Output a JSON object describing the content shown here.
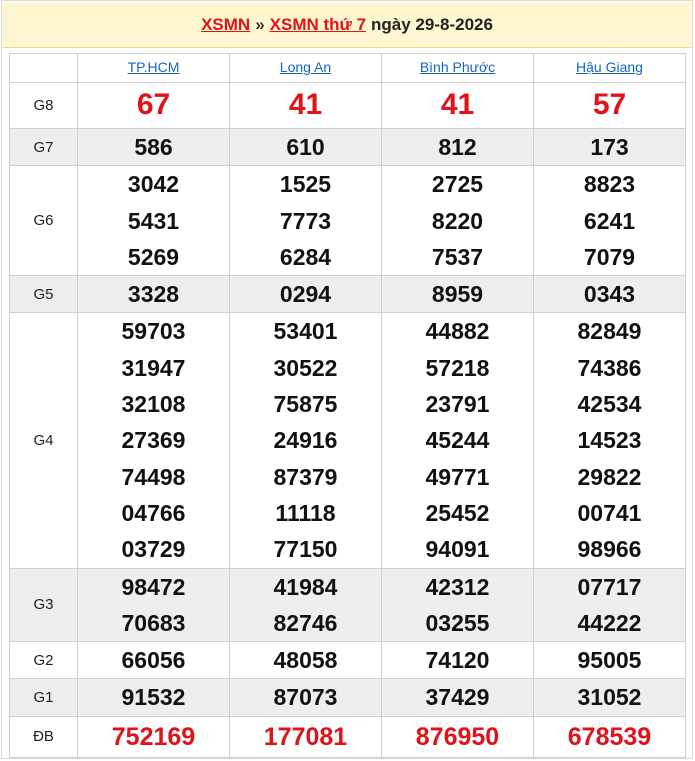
{
  "header": {
    "link1": "XSMN",
    "separator": "»",
    "link2": "XSMN thứ 7",
    "date": "ngày 29-8-2026"
  },
  "provinces": [
    "TP.HCM",
    "Long An",
    "Bình Phước",
    "Hậu Giang"
  ],
  "prizes": [
    {
      "label": "G8",
      "values": [
        [
          "67"
        ],
        [
          "41"
        ],
        [
          "41"
        ],
        [
          "57"
        ]
      ]
    },
    {
      "label": "G7",
      "values": [
        [
          "586"
        ],
        [
          "610"
        ],
        [
          "812"
        ],
        [
          "173"
        ]
      ]
    },
    {
      "label": "G6",
      "values": [
        [
          "3042",
          "5431",
          "5269"
        ],
        [
          "1525",
          "7773",
          "6284"
        ],
        [
          "2725",
          "8220",
          "7537"
        ],
        [
          "8823",
          "6241",
          "7079"
        ]
      ]
    },
    {
      "label": "G5",
      "values": [
        [
          "3328"
        ],
        [
          "0294"
        ],
        [
          "8959"
        ],
        [
          "0343"
        ]
      ]
    },
    {
      "label": "G4",
      "values": [
        [
          "59703",
          "31947",
          "32108",
          "27369",
          "74498",
          "04766",
          "03729"
        ],
        [
          "53401",
          "30522",
          "75875",
          "24916",
          "87379",
          "11118",
          "77150"
        ],
        [
          "44882",
          "57218",
          "23791",
          "45244",
          "49771",
          "25452",
          "94091"
        ],
        [
          "82849",
          "74386",
          "42534",
          "14523",
          "29822",
          "00741",
          "98966"
        ]
      ]
    },
    {
      "label": "G3",
      "values": [
        [
          "98472",
          "70683"
        ],
        [
          "41984",
          "82746"
        ],
        [
          "42312",
          "03255"
        ],
        [
          "07717",
          "44222"
        ]
      ]
    },
    {
      "label": "G2",
      "values": [
        [
          "66056"
        ],
        [
          "48058"
        ],
        [
          "74120"
        ],
        [
          "95005"
        ]
      ]
    },
    {
      "label": "G1",
      "values": [
        [
          "91532"
        ],
        [
          "87073"
        ],
        [
          "37429"
        ],
        [
          "31052"
        ]
      ]
    },
    {
      "label": "ĐB",
      "values": [
        [
          "752169"
        ],
        [
          "177081"
        ],
        [
          "876950"
        ],
        [
          "678539"
        ]
      ]
    }
  ]
}
